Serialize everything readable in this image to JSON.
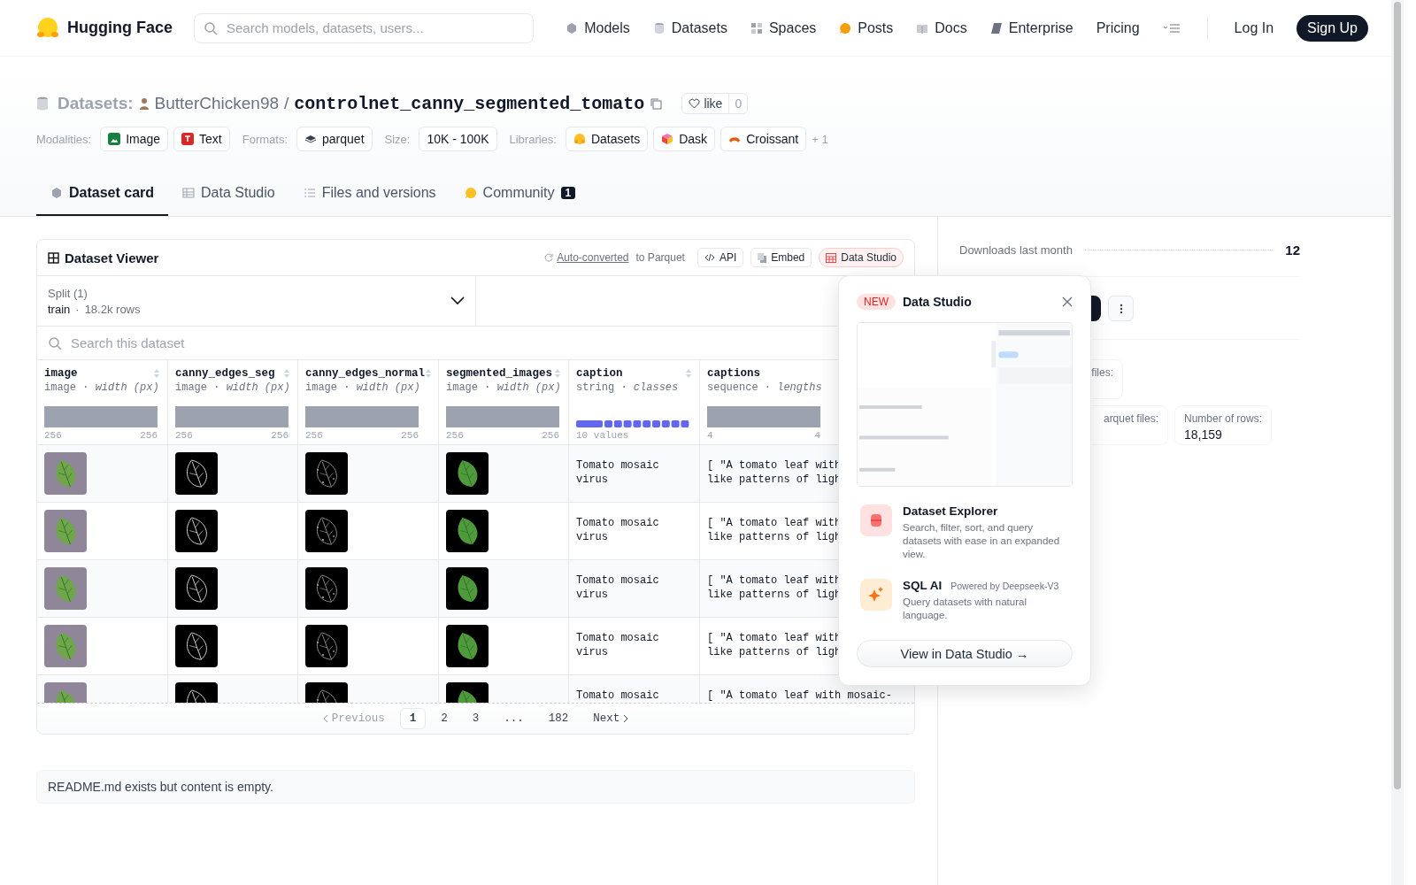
{
  "navbar": {
    "brand": "Hugging Face",
    "search": {
      "placeholder": "Search models, datasets, users..."
    },
    "links": [
      "Models",
      "Datasets",
      "Spaces",
      "Posts",
      "Docs",
      "Enterprise",
      "Pricing"
    ],
    "login": "Log In",
    "signup": "Sign Up"
  },
  "header": {
    "section": "Datasets:",
    "owner": "ButterChicken98",
    "separator": "/",
    "name": "controlnet_canny_segmented_tomato",
    "like": {
      "label": "like",
      "count": "0"
    },
    "tag_groups": [
      {
        "label": "Modalities:",
        "tags": [
          "Image",
          "Text"
        ]
      },
      {
        "label": "Formats:",
        "tags": [
          "parquet"
        ]
      },
      {
        "label": "Size:",
        "tags": [
          "10K - 100K"
        ]
      },
      {
        "label": "Libraries:",
        "tags": [
          "Datasets",
          "Dask",
          "Croissant"
        ],
        "more": "+ 1"
      }
    ]
  },
  "tabs": [
    {
      "label": "Dataset card",
      "selected": true
    },
    {
      "label": "Data Studio",
      "selected": false
    },
    {
      "label": "Files and versions",
      "selected": false
    },
    {
      "label": "Community",
      "selected": false,
      "badge": "1"
    }
  ],
  "viewer": {
    "title": "Dataset Viewer",
    "converted_link": "Auto-converted",
    "converted_suffix": "to Parquet",
    "buttons": [
      {
        "label": "API",
        "selected": false
      },
      {
        "label": "Embed",
        "selected": false
      },
      {
        "label": "Data Studio",
        "selected": true
      }
    ],
    "split": {
      "label": "Split (1)",
      "value": "train",
      "separator": "·",
      "rows": "18.2k rows"
    },
    "search": {
      "placeholder": "Search this dataset"
    },
    "dot": "·",
    "columns": [
      {
        "name": "image",
        "type": "image",
        "stat": "width (px)",
        "kind": "range",
        "min": "256",
        "max": "256"
      },
      {
        "name": "canny_edges_seg",
        "type": "image",
        "stat": "width (px)",
        "kind": "range",
        "min": "256",
        "max": "256"
      },
      {
        "name": "canny_edges_normal",
        "type": "image",
        "stat": "width (px)",
        "kind": "range",
        "min": "256",
        "max": "256"
      },
      {
        "name": "segmented_images",
        "type": "image",
        "stat": "width (px)",
        "kind": "range",
        "min": "256",
        "max": "256"
      },
      {
        "name": "caption",
        "type": "string",
        "stat": "classes",
        "kind": "classes",
        "summary": "10 values"
      },
      {
        "name": "captions",
        "type": "sequence",
        "stat": "lengths",
        "kind": "range",
        "min": "4",
        "max": "4"
      }
    ],
    "rows": [
      {
        "caption": "Tomato mosaic virus",
        "captions": [
          "[ \"A tomato leaf with",
          "like patterns of ligh"
        ]
      },
      {
        "caption": "Tomato mosaic virus",
        "captions": [
          "[ \"A tomato leaf with",
          "like patterns of ligh"
        ]
      },
      {
        "caption": "Tomato mosaic virus",
        "captions": [
          "[ \"A tomato leaf with",
          "like patterns of ligh"
        ]
      },
      {
        "caption": "Tomato mosaic virus",
        "captions": [
          "[ \"A tomato leaf with",
          "like patterns of ligh"
        ]
      },
      {
        "caption": "Tomato mosaic",
        "captions": [
          "[ \"A tomato leaf with mosaic-"
        ]
      }
    ],
    "pagination": {
      "previous": {
        "label": "Previous",
        "disabled": true
      },
      "pages": [
        {
          "label": "1",
          "selected": true
        },
        {
          "label": "2",
          "selected": false
        },
        {
          "label": "3",
          "selected": false
        },
        {
          "label": "...",
          "selected": false
        },
        {
          "label": "182",
          "selected": false
        }
      ],
      "next": {
        "label": "Next",
        "disabled": false
      }
    }
  },
  "readme": "README.md exists but content is empty.",
  "sidebar": {
    "downloads": {
      "label": "Downloads last month",
      "value": "12"
    },
    "stats": [
      {
        "label": "files:"
      },
      {
        "label": "arquet files:"
      },
      {
        "label": "Number of rows:",
        "value": "18,159"
      }
    ]
  },
  "popover": {
    "badge": "NEW",
    "title": "Data Studio",
    "features": [
      {
        "title": "Dataset Explorer",
        "description": "Search, filter, sort, and query datasets with ease in an expanded view."
      },
      {
        "title": "SQL AI",
        "note": "Powered by Deepseek-V3",
        "description": "Query datasets with natural language."
      }
    ],
    "cta": "View in Data Studio →"
  }
}
